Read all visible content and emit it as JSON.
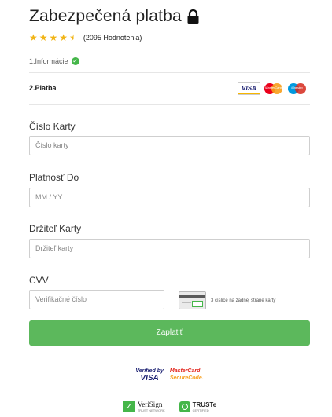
{
  "header": {
    "title": "Zabezpečená platba",
    "rating_text": "(2095 Hodnotenia)",
    "stars": 4.5
  },
  "steps": {
    "step1": "1.Informácie",
    "step2": "2.Platba"
  },
  "payment_cards": {
    "visa": "VISA",
    "mastercard": "MasterCard",
    "maestro": "Maestro"
  },
  "form": {
    "card_number": {
      "label": "Číslo Karty",
      "placeholder": "Číslo karty"
    },
    "expiry": {
      "label": "Platnosť Do",
      "placeholder": "MM / YY"
    },
    "holder": {
      "label": "Držiteľ Karty",
      "placeholder": "Držiteľ karty"
    },
    "cvv": {
      "label": "CVV",
      "placeholder": "Verifikačné číslo",
      "hint": "3 číslice na zadnej strane karty"
    }
  },
  "pay_button": "Zaplatiť",
  "badges": {
    "verified_by": "Verified by",
    "visa": "VISA",
    "mastercard": "MasterCard",
    "securecode": "SecureCode."
  },
  "seals": {
    "verisign": "VeriSign",
    "verisign_sub": "TRUST NETWORK",
    "truste": "TRUSTe",
    "truste_sub": "CERTIFIED"
  },
  "colors": {
    "accent_green": "#5cb85c",
    "star_gold": "#f1b416"
  }
}
